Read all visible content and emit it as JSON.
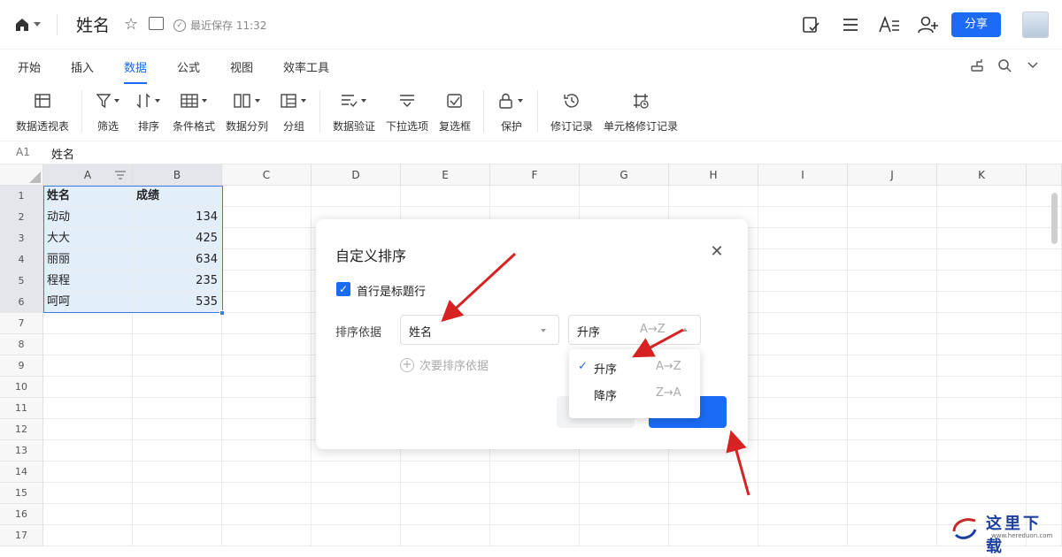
{
  "topbar": {
    "doc_title": "姓名",
    "save_status": "最近保存 11:32",
    "share_label": "分享"
  },
  "tabs": [
    "开始",
    "插入",
    "数据",
    "公式",
    "视图",
    "效率工具"
  ],
  "active_tab": "数据",
  "toolbar": {
    "pivot": "数据透视表",
    "filter": "筛选",
    "sort": "排序",
    "cond_format": "条件格式",
    "split": "数据分列",
    "group": "分组",
    "validation": "数据验证",
    "dropdown": "下拉选项",
    "checkbox": "复选框",
    "protect": "保护",
    "history": "修订记录",
    "cell_history": "单元格修订记录"
  },
  "formula_bar": {
    "cell_ref": "A1",
    "value": "姓名"
  },
  "sheet": {
    "columns": [
      "A",
      "B",
      "C",
      "D",
      "E",
      "F",
      "G",
      "H",
      "I",
      "J",
      "K"
    ],
    "rows": [
      "1",
      "2",
      "3",
      "4",
      "5",
      "6",
      "7",
      "8",
      "9",
      "10",
      "11",
      "12",
      "13",
      "14",
      "15",
      "16",
      "17"
    ],
    "cells": {
      "a1": "姓名",
      "b1": "成绩",
      "a2": "动动",
      "b2": "134",
      "a3": "大大",
      "b3": "425",
      "a4": "丽丽",
      "b4": "634",
      "a5": "程程",
      "b5": "235",
      "a6": "呵呵",
      "b6": "535"
    }
  },
  "dialog": {
    "title": "自定义排序",
    "header_row_label": "首行是标题行",
    "header_row_checked": true,
    "sort_by_label": "排序依据",
    "sort_key": "姓名",
    "sort_order": "升序",
    "sort_order_hint": "A→Z",
    "add_secondary": "次要排序依据"
  },
  "order_menu": {
    "items": [
      {
        "label": "升序",
        "hint": "A→Z",
        "selected": true
      },
      {
        "label": "降序",
        "hint": "Z→A",
        "selected": false
      }
    ]
  },
  "watermark": {
    "title": "这里下载",
    "subtitle": "www.hereduon.com"
  },
  "colors": {
    "accent": "#1b6bf5",
    "selection": "#e3eefb",
    "annotation_arrow": "#d62222"
  }
}
